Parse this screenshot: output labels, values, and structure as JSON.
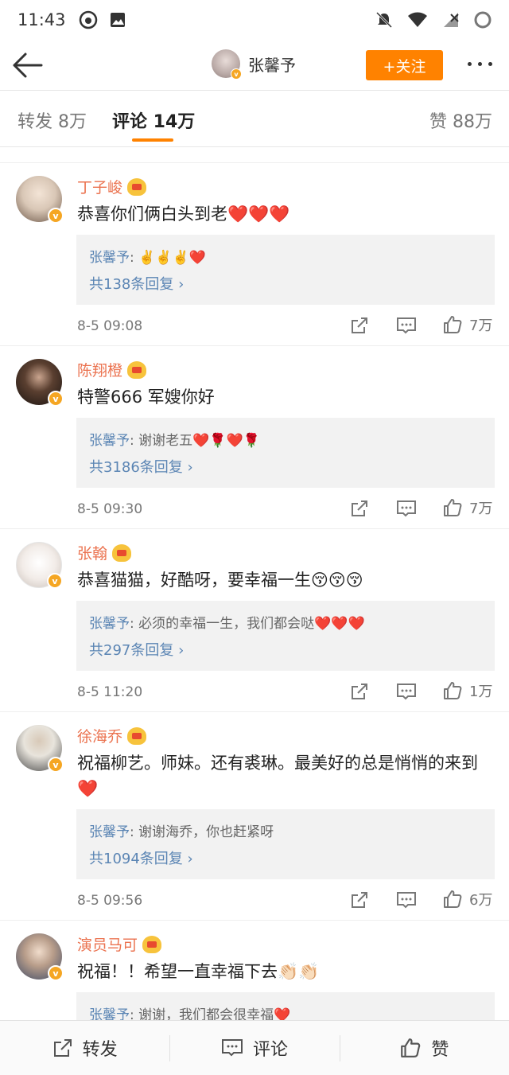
{
  "status": {
    "time": "11:43"
  },
  "nav": {
    "username": "张馨予",
    "follow_label": "+关注"
  },
  "tabs": {
    "repost": "转发 8万",
    "comment": "评论 14万",
    "like": "赞 88万"
  },
  "comments": [
    {
      "name": "丁子峻",
      "text": "恭喜你们俩白头到老❤️❤️❤️",
      "reply_name": "张馨予",
      "reply_text": "✌️✌️✌️❤️",
      "reply_count": "共138条回复",
      "time": "8-5 09:08",
      "likes": "7万",
      "avatar_color": "#d9c7b6"
    },
    {
      "name": "陈翔橙",
      "text": "特警666 军嫂你好",
      "reply_name": "张馨予",
      "reply_text": "谢谢老五❤️🌹❤️🌹",
      "reply_count": "共3186条回复",
      "time": "8-5 09:30",
      "likes": "7万",
      "avatar_color": "#3a2a22"
    },
    {
      "name": "张翰",
      "text": "恭喜猫猫，好酷呀，要幸福一生😚😚😚",
      "reply_name": "张馨予",
      "reply_text": "必须的幸福一生，我们都会哒❤️❤️❤️",
      "reply_count": "共297条回复",
      "time": "8-5 11:20",
      "likes": "1万",
      "avatar_color": "#f2ece8"
    },
    {
      "name": "徐海乔",
      "text": "祝福柳艺。师妹。还有裘琳。最美好的总是悄悄的来到❤️",
      "reply_name": "张馨予",
      "reply_text": "谢谢海乔，你也赶紧呀",
      "reply_count": "共1094条回复",
      "time": "8-5 09:56",
      "likes": "6万",
      "avatar_color": "#e8e4dc"
    },
    {
      "name": "演员马可",
      "text": "祝福！！希望一直幸福下去👏🏻👏🏻",
      "reply_name": "张馨予",
      "reply_text": "谢谢，我们都会很幸福❤️",
      "reply_count": "",
      "time": "",
      "likes": "",
      "avatar_color": "#6b7fa0"
    }
  ],
  "bottom": {
    "repost": "转发",
    "comment": "评论",
    "like": "赞"
  },
  "colors": {
    "accent": "#ff8200",
    "username": "#eb7350",
    "link": "#5b85b4"
  }
}
